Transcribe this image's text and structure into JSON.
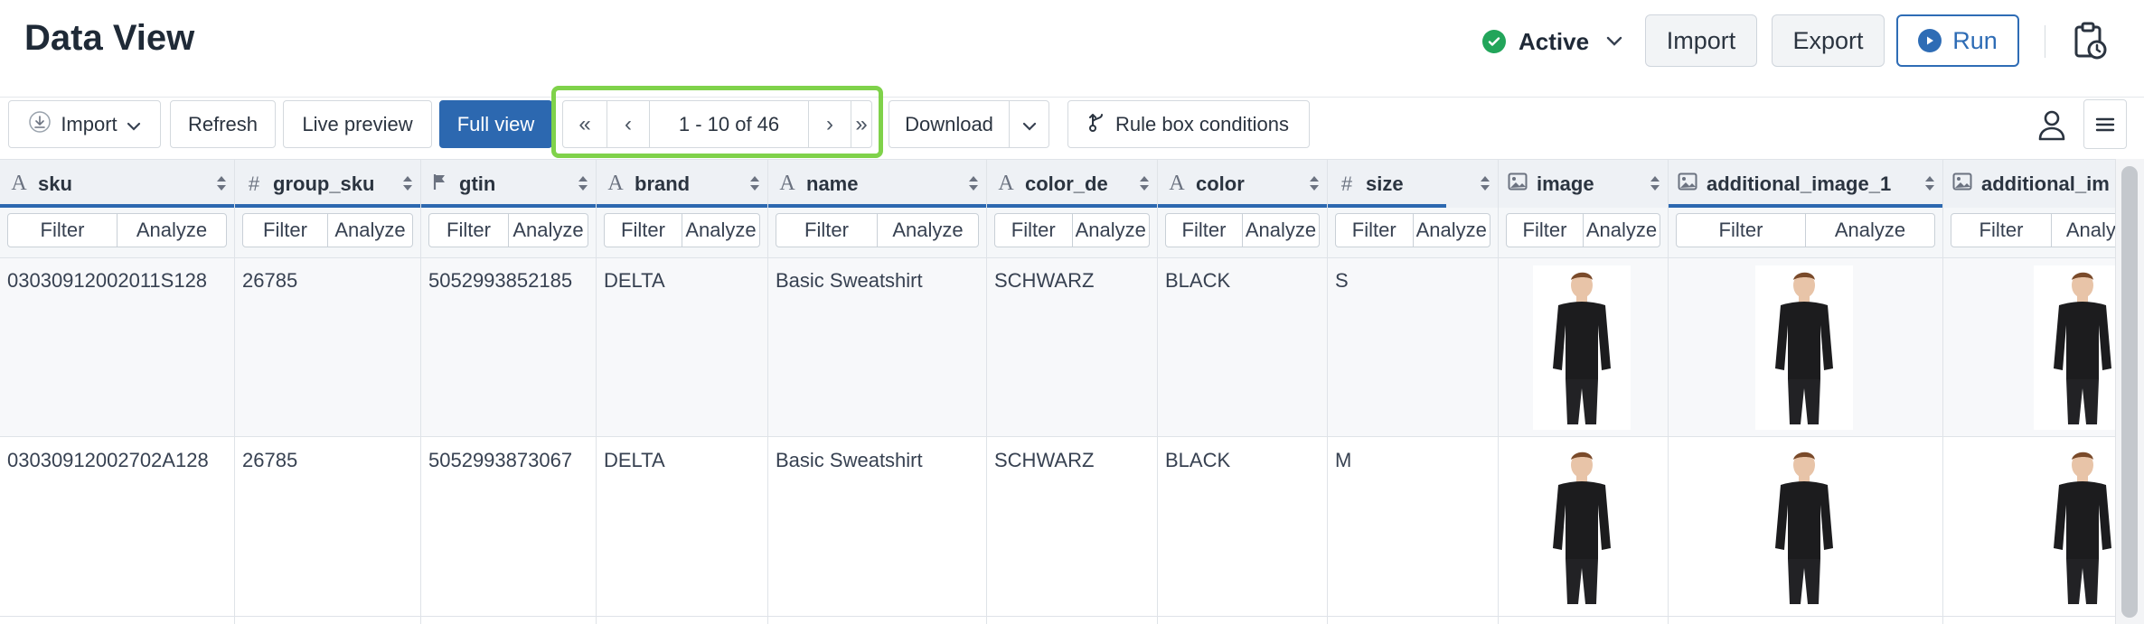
{
  "header": {
    "title": "Data View",
    "status_label": "Active",
    "status_color": "#22a55a",
    "import_label": "Import",
    "export_label": "Export",
    "run_label": "Run",
    "accent_color": "#2e6cb5"
  },
  "toolbar": {
    "import_label": "Import",
    "refresh_label": "Refresh",
    "live_preview_label": "Live preview",
    "full_view_label": "Full view",
    "pager": {
      "first": "«",
      "prev": "‹",
      "info": "1 - 10 of 46",
      "next": "›",
      "last": "»"
    },
    "download_label": "Download",
    "rules_label": "Rule box conditions",
    "highlight_color": "#7fd24a"
  },
  "grid": {
    "filter_label": "Filter",
    "analyze_label": "Analyze",
    "columns": [
      {
        "name": "sku",
        "type_icon": "A"
      },
      {
        "name": "group_sku",
        "type_icon": "#"
      },
      {
        "name": "gtin",
        "type_icon": "flag"
      },
      {
        "name": "brand",
        "type_icon": "A"
      },
      {
        "name": "name",
        "type_icon": "A"
      },
      {
        "name": "color_de",
        "type_icon": "A"
      },
      {
        "name": "color",
        "type_icon": "A"
      },
      {
        "name": "size",
        "type_icon": "#"
      },
      {
        "name": "image",
        "type_icon": "image"
      },
      {
        "name": "additional_image_1",
        "type_icon": "image"
      },
      {
        "name": "additional_im",
        "type_icon": "image"
      }
    ],
    "rows": [
      [
        "03030912002011S128",
        "26785",
        "5052993852185",
        "DELTA",
        "Basic Sweatshirt",
        "SCHWARZ",
        "BLACK",
        "S"
      ],
      [
        "03030912002702A128",
        "26785",
        "5052993873067",
        "DELTA",
        "Basic Sweatshirt",
        "SCHWARZ",
        "BLACK",
        "M"
      ]
    ]
  }
}
